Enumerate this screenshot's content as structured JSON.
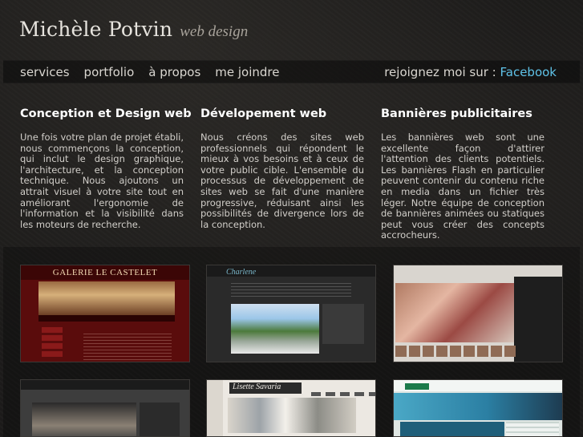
{
  "header": {
    "name": "Michèle Potvin",
    "tagline": "web design"
  },
  "nav": {
    "items": [
      {
        "label": "services"
      },
      {
        "label": "portfolio"
      },
      {
        "label": "à propos"
      },
      {
        "label": "me joindre"
      }
    ],
    "social_prefix": "rejoignez moi sur :",
    "social_link": "Facebook"
  },
  "columns": [
    {
      "title": "Conception et Design web",
      "text": "Une fois votre plan de projet établi, nous commençons la conception, qui inclut le design graphique, l'architecture, et la conception technique. Nous ajoutons un attrait visuel à votre site tout en améliorant l'ergonomie de l'information et la visibilité dans les moteurs de recherche."
    },
    {
      "title": "Dévelopement web",
      "text": "Nous créons des sites web professionnels qui répondent le mieux à vos besoins et à ceux de votre public cible. L'ensemble du processus de développement de sites web se fait d'une manière progressive, réduisant ainsi les possibilités de divergence lors de la conception."
    },
    {
      "title": "Bannières publicitaires",
      "text": "Les bannières web sont une excellente façon d'attirer l'attention des clients potentiels. Les bannières Flash en particulier peuvent contenir du contenu riche en media dans un fichier très léger. Notre équipe de conception de bannières animées ou statiques peut vous créer des concepts accrocheurs."
    }
  ],
  "portfolio": {
    "thumbs": [
      {
        "title": "GALERIE LE CASTELET"
      },
      {
        "title": "Charlene"
      },
      {
        "title": ""
      },
      {
        "title": ""
      },
      {
        "title": "Lisette Savaria"
      },
      {
        "title": ""
      }
    ]
  }
}
